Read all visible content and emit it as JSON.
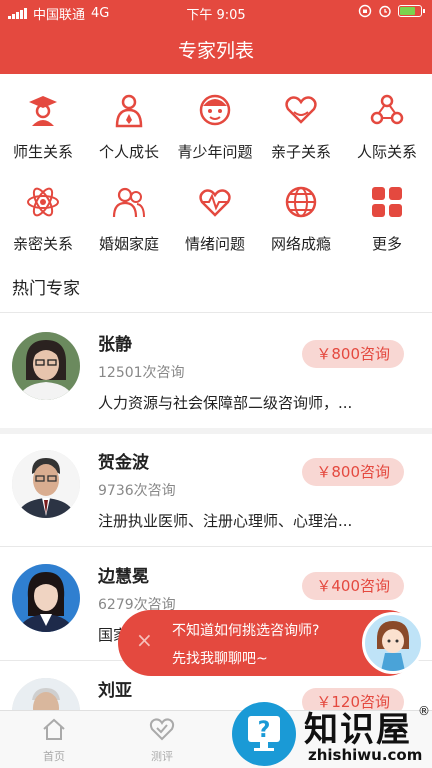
{
  "status": {
    "carrier": "中国联通",
    "network": "4G",
    "time": "下午 9:05"
  },
  "header": {
    "title": "专家列表"
  },
  "categories": [
    {
      "label": "师生关系",
      "icon": "graduate-icon"
    },
    {
      "label": "个人成长",
      "icon": "person-icon"
    },
    {
      "label": "青少年问题",
      "icon": "child-face-icon"
    },
    {
      "label": "亲子关系",
      "icon": "heart-hands-icon"
    },
    {
      "label": "人际关系",
      "icon": "people-network-icon"
    },
    {
      "label": "亲密关系",
      "icon": "atom-icon"
    },
    {
      "label": "婚姻家庭",
      "icon": "couple-icon"
    },
    {
      "label": "情绪问题",
      "icon": "heartbeat-icon"
    },
    {
      "label": "网络成瘾",
      "icon": "globe-icon"
    },
    {
      "label": "更多",
      "icon": "grid-icon"
    }
  ],
  "section": {
    "hot_title": "热门专家"
  },
  "experts": [
    {
      "name": "张静",
      "count": "12501次咨询",
      "desc": "人力资源与社会保障部二级咨询师，...",
      "price": "￥800咨询"
    },
    {
      "name": "贺金波",
      "count": "9736次咨询",
      "desc": "注册执业医师、注册心理师、心理治...",
      "price": "￥800咨询"
    },
    {
      "name": "边慧冕",
      "count": "6279次咨询",
      "desc": "国家",
      "price": "￥400咨询"
    },
    {
      "name": "刘亚",
      "count": "",
      "desc": "",
      "price": "￥120咨询"
    }
  ],
  "prompt": {
    "line1": "不知道如何挑选咨询师?",
    "line2": "先找我聊聊吧~",
    "close": "×"
  },
  "tabs": [
    {
      "label": "首页"
    },
    {
      "label": "测评"
    }
  ],
  "watermark": {
    "big": "知识屋",
    "small": "zhishiwu.com",
    "reg": "®"
  },
  "colors": {
    "brand": "#e4493f",
    "price_bg": "#f8d7d3"
  }
}
